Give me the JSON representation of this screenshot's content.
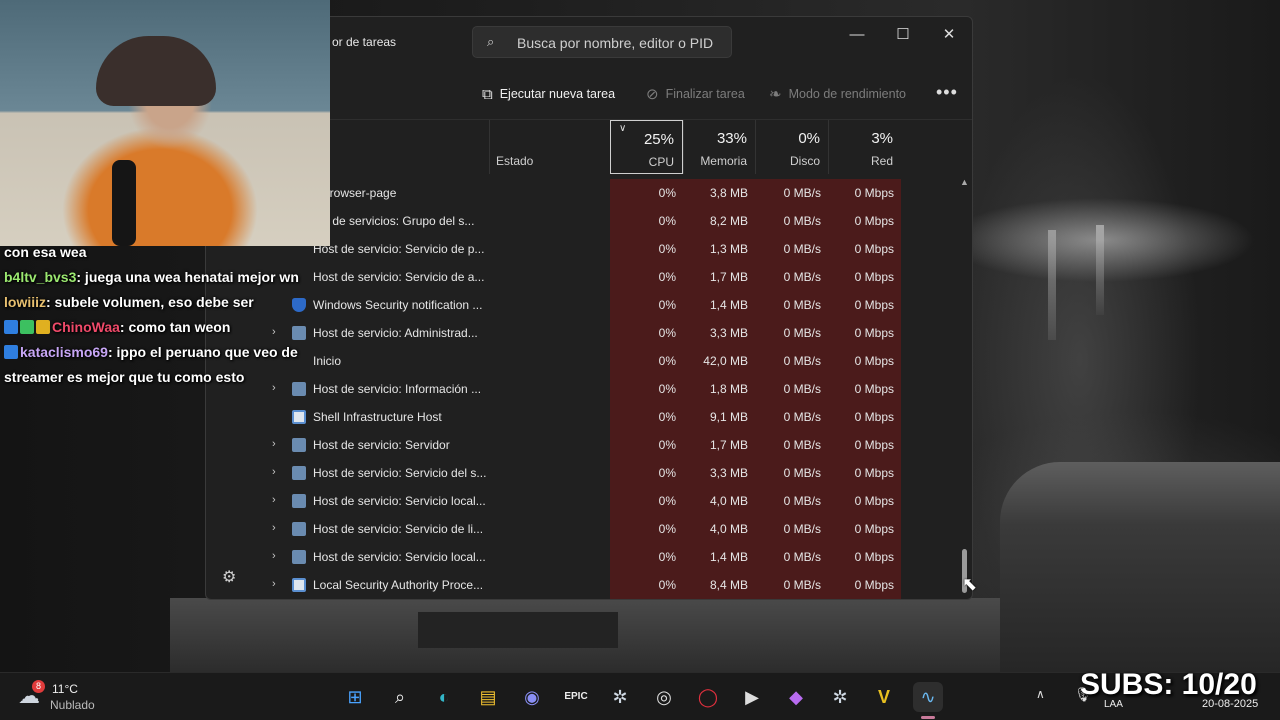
{
  "window": {
    "title": "or de tareas",
    "search_placeholder": "Busca por nombre, editor o PID",
    "minimize": "—",
    "maximize": "☐",
    "close": "✕"
  },
  "toolbar": {
    "run_task": "Ejecutar nueva tarea",
    "end_task": "Finalizar tarea",
    "efficiency": "Modo de rendimiento",
    "more": "•••"
  },
  "columns": {
    "estado": "Estado",
    "cpu": {
      "pct": "25%",
      "label": "CPU"
    },
    "memory": {
      "pct": "33%",
      "label": "Memoria"
    },
    "disk": {
      "pct": "0%",
      "label": "Disco"
    },
    "network": {
      "pct": "3%",
      "label": "Red"
    }
  },
  "processes": [
    {
      "name": "s-browser-page",
      "expand": "",
      "icon": "none",
      "cpu": "0%",
      "mem": "3,8 MB",
      "disk": "0 MB/s",
      "net": "0 Mbps"
    },
    {
      "name": "ost de servicios: Grupo del s...",
      "expand": "",
      "icon": "none",
      "cpu": "0%",
      "mem": "8,2 MB",
      "disk": "0 MB/s",
      "net": "0 Mbps"
    },
    {
      "name": "Host de servicio: Servicio de p...",
      "expand": "",
      "icon": "none",
      "cpu": "0%",
      "mem": "1,3 MB",
      "disk": "0 MB/s",
      "net": "0 Mbps"
    },
    {
      "name": "Host de servicio: Servicio de a...",
      "expand": "",
      "icon": "none",
      "cpu": "0%",
      "mem": "1,7 MB",
      "disk": "0 MB/s",
      "net": "0 Mbps"
    },
    {
      "name": "Windows Security notification ...",
      "expand": "",
      "icon": "shield",
      "cpu": "0%",
      "mem": "1,4 MB",
      "disk": "0 MB/s",
      "net": "0 Mbps"
    },
    {
      "name": "Host de servicio: Administrad...",
      "expand": "›",
      "icon": "gear",
      "cpu": "0%",
      "mem": "3,3 MB",
      "disk": "0 MB/s",
      "net": "0 Mbps"
    },
    {
      "name": "Inicio",
      "expand": "",
      "icon": "none",
      "cpu": "0%",
      "mem": "42,0 MB",
      "disk": "0 MB/s",
      "net": "0 Mbps"
    },
    {
      "name": "Host de servicio: Información ...",
      "expand": "›",
      "icon": "gear",
      "cpu": "0%",
      "mem": "1,8 MB",
      "disk": "0 MB/s",
      "net": "0 Mbps"
    },
    {
      "name": "Shell Infrastructure Host",
      "expand": "",
      "icon": "win",
      "cpu": "0%",
      "mem": "9,1 MB",
      "disk": "0 MB/s",
      "net": "0 Mbps"
    },
    {
      "name": "Host de servicio: Servidor",
      "expand": "›",
      "icon": "gear",
      "cpu": "0%",
      "mem": "1,7 MB",
      "disk": "0 MB/s",
      "net": "0 Mbps"
    },
    {
      "name": "Host de servicio: Servicio del s...",
      "expand": "›",
      "icon": "gear",
      "cpu": "0%",
      "mem": "3,3 MB",
      "disk": "0 MB/s",
      "net": "0 Mbps"
    },
    {
      "name": "Host de servicio: Servicio local...",
      "expand": "›",
      "icon": "gear",
      "cpu": "0%",
      "mem": "4,0 MB",
      "disk": "0 MB/s",
      "net": "0 Mbps"
    },
    {
      "name": "Host de servicio: Servicio de li...",
      "expand": "›",
      "icon": "gear",
      "cpu": "0%",
      "mem": "4,0 MB",
      "disk": "0 MB/s",
      "net": "0 Mbps"
    },
    {
      "name": "Host de servicio: Servicio local...",
      "expand": "›",
      "icon": "gear",
      "cpu": "0%",
      "mem": "1,4 MB",
      "disk": "0 MB/s",
      "net": "0 Mbps"
    },
    {
      "name": "Local Security Authority Proce...",
      "expand": "›",
      "icon": "win",
      "cpu": "0%",
      "mem": "8,4 MB",
      "disk": "0 MB/s",
      "net": "0 Mbps"
    }
  ],
  "chat": [
    {
      "user": "",
      "user_color": "#ffffff",
      "message": "con esa wea",
      "badges": []
    },
    {
      "user": "b4ltv_bvs3",
      "user_color": "#9be870",
      "message": ": juega una wea henatai mejor wn",
      "badges": []
    },
    {
      "user": "lowiiiz",
      "user_color": "#e8c070",
      "message": ": subele volumen, eso debe ser",
      "badges": []
    },
    {
      "user": "ChinoWaa",
      "user_color": "#f04a6a",
      "message": ": como tan weon",
      "badges": [
        "blue",
        "green",
        "gold"
      ]
    },
    {
      "user": "kataclismo69",
      "user_color": "#c7a6f5",
      "message": ": ippo el peruano que veo de",
      "badges": [
        "blue"
      ]
    },
    {
      "user": "",
      "user_color": "#ffffff",
      "message": "streamer es mejor que tu como esto",
      "badges": []
    }
  ],
  "taskbar": {
    "weather_temp": "11°C",
    "weather_desc": "Nublado",
    "weather_badge": "8",
    "epic_label": "EPIC",
    "vegas_label": "V",
    "lang": "LAA",
    "date": "20-08-2025"
  },
  "overlay": {
    "subs": "SUBS: 10/20"
  },
  "colors": {
    "heat": "#4b1b1b",
    "window_bg": "#202020",
    "accent": "#4aa3ff"
  }
}
